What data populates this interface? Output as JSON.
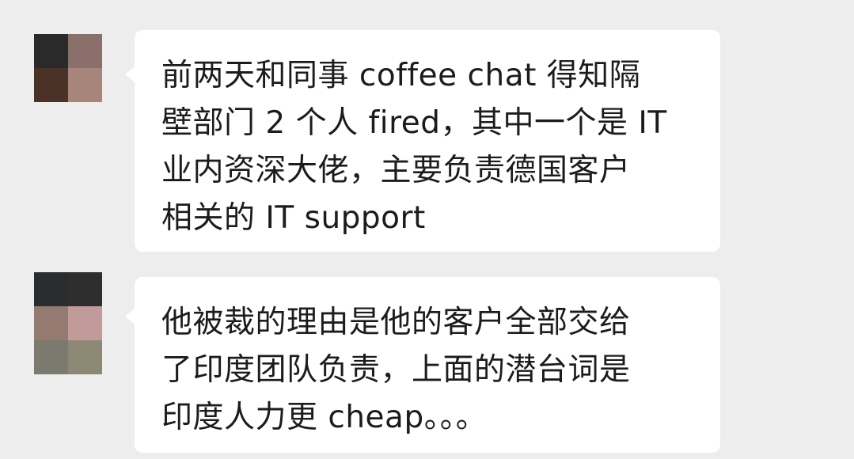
{
  "messages": [
    {
      "text": "前两天和同事 coffee chat 得知隔\n壁部门 2 个人 fired，其中一个是 IT\n业内资深大佬，主要负责德国客户\n相关的 IT support",
      "avatar_colors": [
        "#2a2a2a",
        "#8a6f6a",
        "#4a3226",
        "#a8857a"
      ]
    },
    {
      "text": "他被裁的理由是他的客户全部交给\n了印度团队负责，上面的潜台词是\n印度人力更 cheap。。。",
      "avatar_colors": [
        "#2b2c30",
        "#2e2e2e",
        "#957a72",
        "#c29a9a",
        "#7c7a6e",
        "#8c8874"
      ]
    }
  ]
}
